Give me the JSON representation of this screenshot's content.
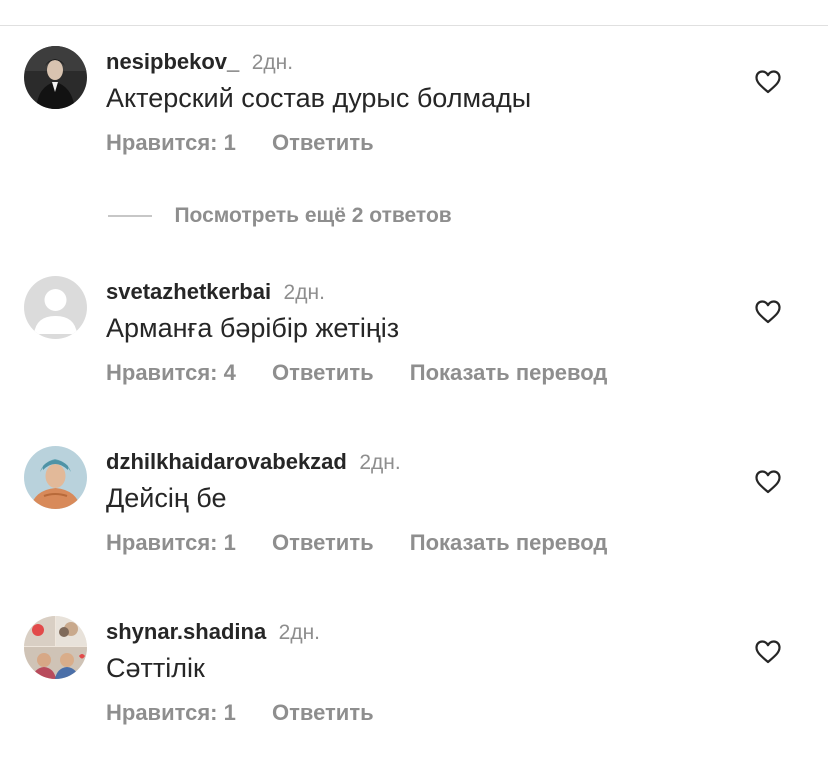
{
  "comments": [
    {
      "username": "nesipbekov_",
      "time": "2дн.",
      "text": "Актерский состав дурыс болмады",
      "likes": "Нравится: 1",
      "reply": "Ответить",
      "translate": ""
    },
    {
      "username": "svetazhetkerbai",
      "time": "2дн.",
      "text": "Арманға бәрібір жетіңіз",
      "likes": "Нравится: 4",
      "reply": "Ответить",
      "translate": "Показать перевод"
    },
    {
      "username": "dzhilkhaidarovabekzad",
      "time": "2дн.",
      "text": "Дейсің бе",
      "likes": "Нравится: 1",
      "reply": "Ответить",
      "translate": "Показать перевод"
    },
    {
      "username": "shynar.shadina",
      "time": "2дн.",
      "text": "Сәттілік",
      "likes": "Нравится: 1",
      "reply": "Ответить",
      "translate": ""
    }
  ],
  "more_replies": {
    "label": "Посмотреть ещё 2 ответов"
  },
  "icons": {
    "like": "heart-outline-icon",
    "default_avatar": "default-user-avatar-icon"
  },
  "colors": {
    "primary_text": "#262626",
    "secondary_text": "#8e8e8e",
    "divider": "#e0e0e0"
  }
}
